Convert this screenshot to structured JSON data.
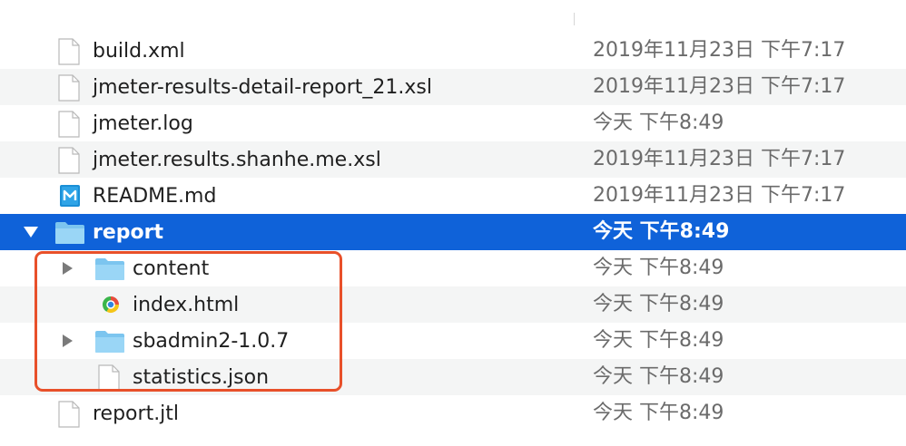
{
  "files": [
    {
      "name": "build.xml",
      "date": "2019年11月23日 下午7:17",
      "icon": "document-icon",
      "indent": 0,
      "kind": "file"
    },
    {
      "name": "jmeter-results-detail-report_21.xsl",
      "date": "2019年11月23日 下午7:17",
      "icon": "document-icon",
      "indent": 0,
      "kind": "file"
    },
    {
      "name": "jmeter.log",
      "date": "今天 下午8:49",
      "icon": "document-icon",
      "indent": 0,
      "kind": "file"
    },
    {
      "name": "jmeter.results.shanhe.me.xsl",
      "date": "2019年11月23日 下午7:17",
      "icon": "document-icon",
      "indent": 0,
      "kind": "file"
    },
    {
      "name": "README.md",
      "date": "2019年11月23日 下午7:17",
      "icon": "markdown-icon",
      "indent": 0,
      "kind": "file"
    },
    {
      "name": "report",
      "date": "今天 下午8:49",
      "icon": "folder-icon",
      "indent": 0,
      "kind": "folder",
      "expanded": true,
      "selected": true
    },
    {
      "name": "content",
      "date": "今天 下午8:49",
      "icon": "folder-icon",
      "indent": 1,
      "kind": "folder",
      "expanded": false
    },
    {
      "name": "index.html",
      "date": "今天 下午8:49",
      "icon": "html-file-icon",
      "indent": 1,
      "kind": "file"
    },
    {
      "name": "sbadmin2-1.0.7",
      "date": "今天 下午8:49",
      "icon": "folder-icon",
      "indent": 1,
      "kind": "folder",
      "expanded": false
    },
    {
      "name": "statistics.json",
      "date": "今天 下午8:49",
      "icon": "document-icon",
      "indent": 1,
      "kind": "file"
    },
    {
      "name": "report.jtl",
      "date": "今天 下午8:49",
      "icon": "document-icon",
      "indent": 0,
      "kind": "file"
    }
  ],
  "colors": {
    "selection": "#0f62d9",
    "highlight_box": "#e8502a",
    "folder": "#8fd0f3",
    "alt_row": "#f4f5f5"
  }
}
